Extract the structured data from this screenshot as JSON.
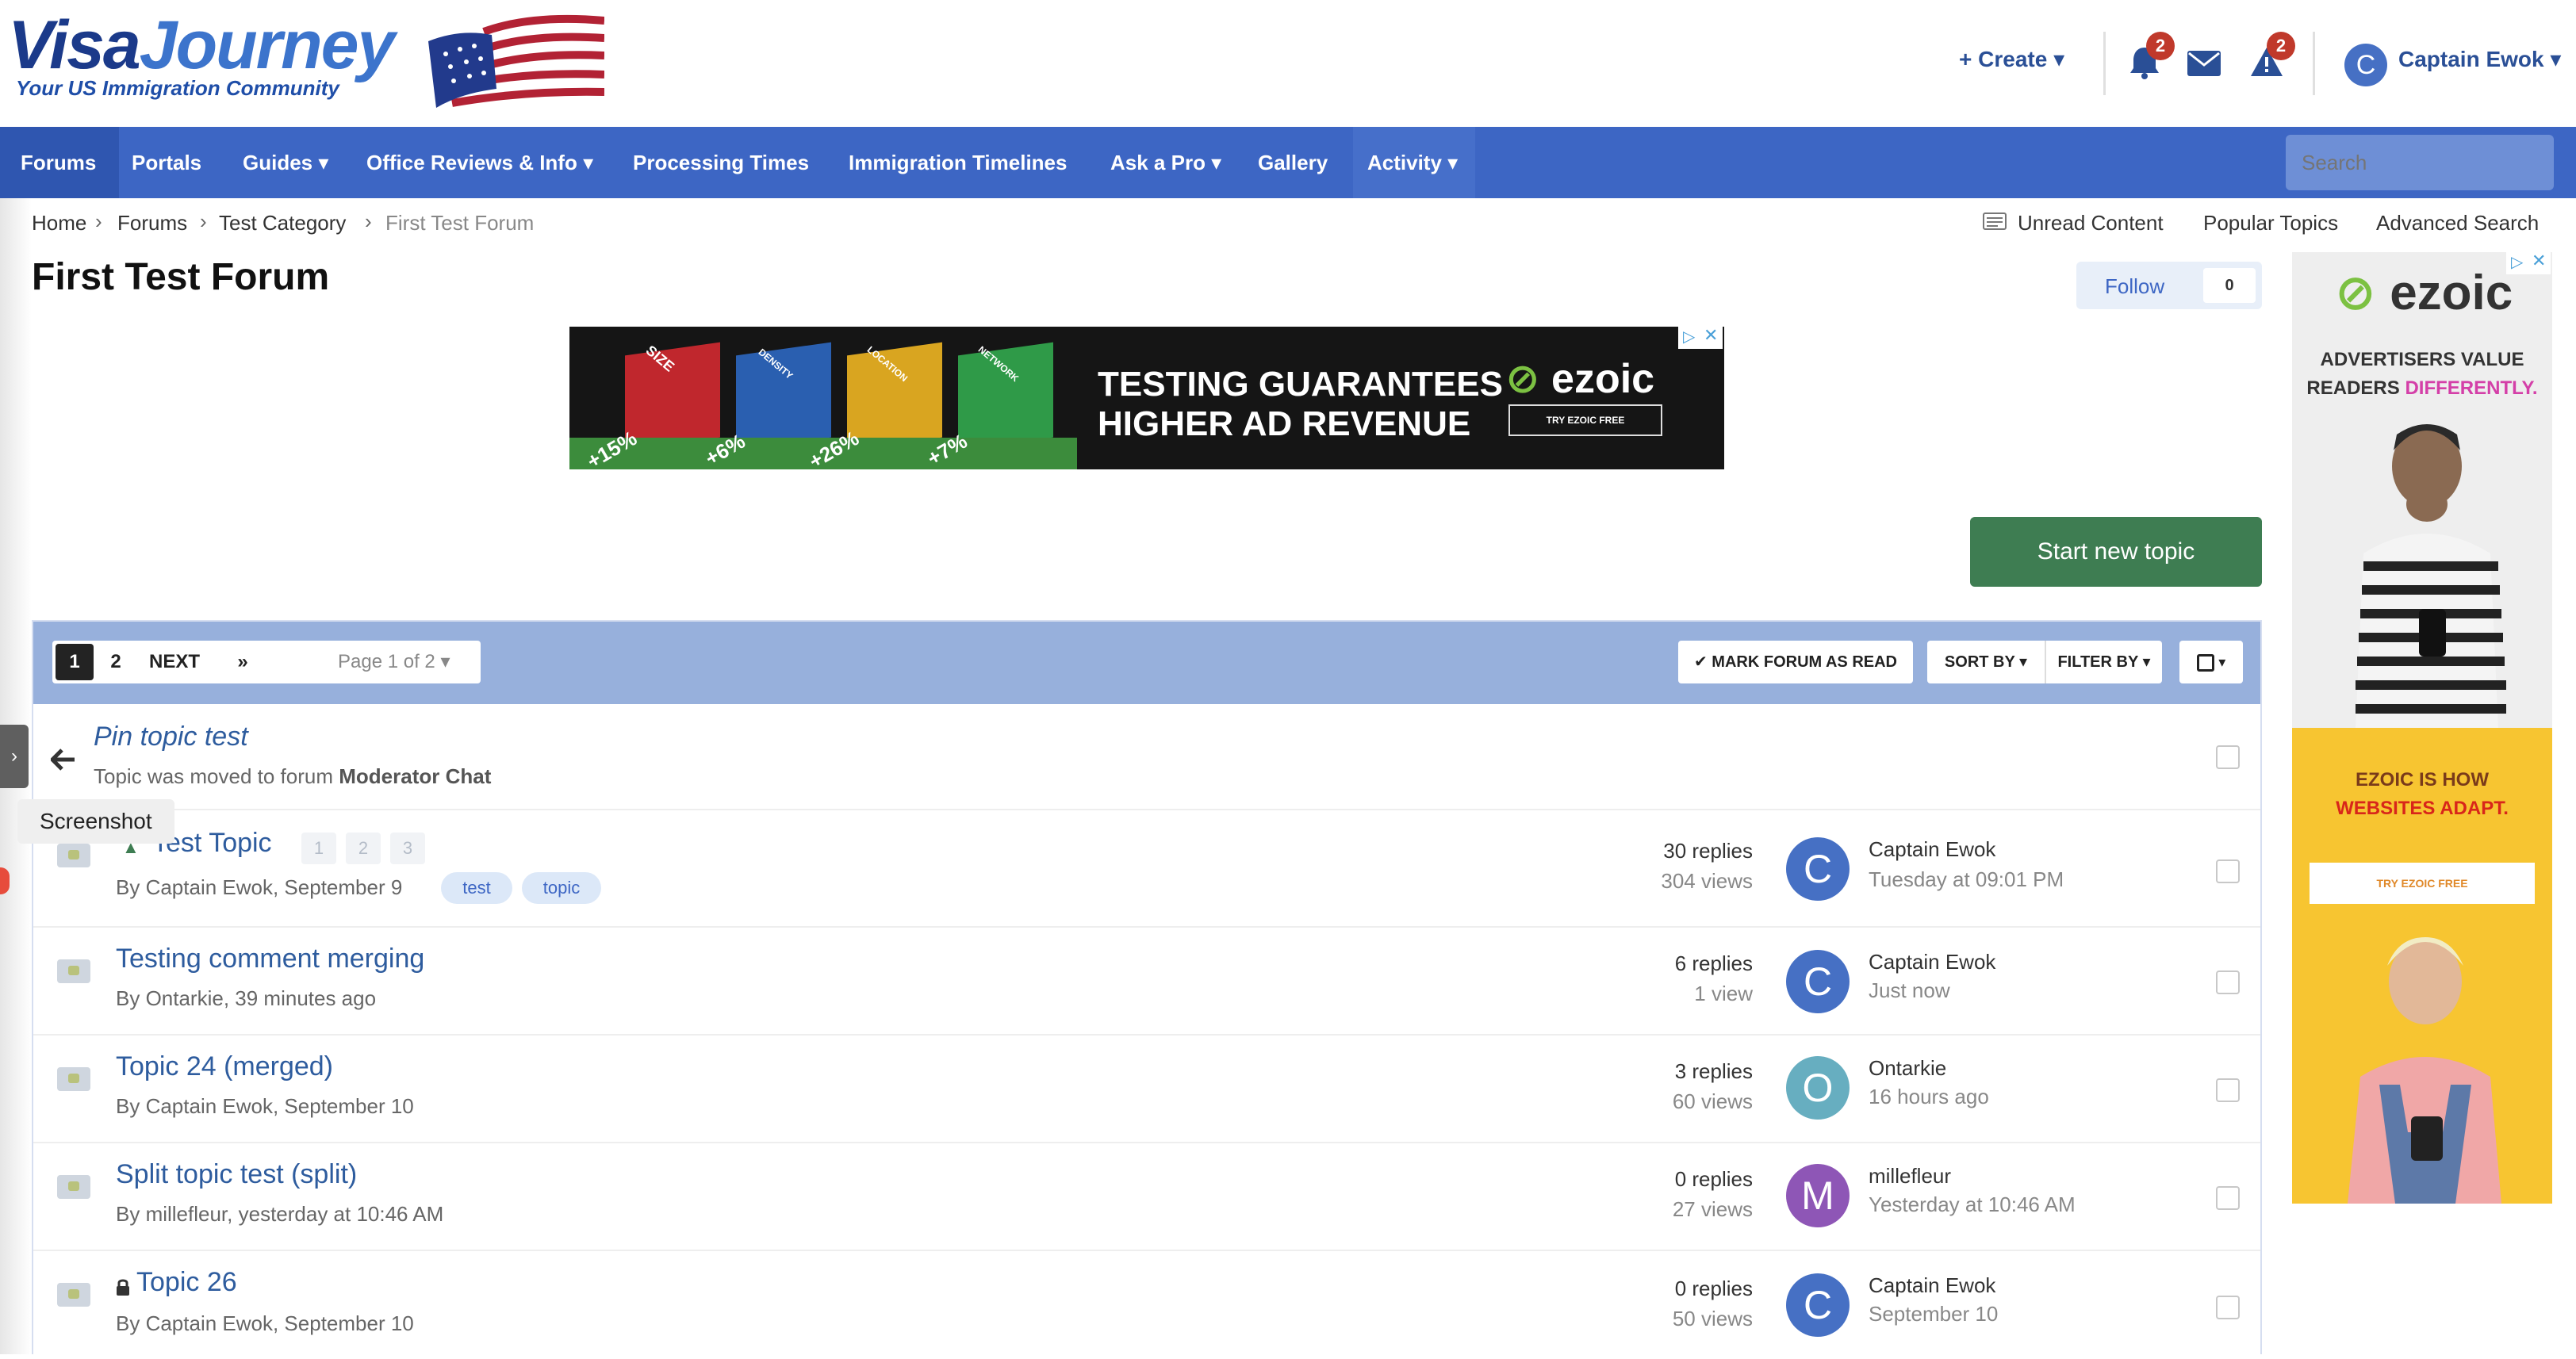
{
  "header": {
    "logo_part1": "Visa",
    "logo_part2": "Journey",
    "tagline": "Your US Immigration Community",
    "create_label": "Create",
    "notifications_count": "2",
    "reports_count": "2",
    "user_initial": "C",
    "user_name": "Captain Ewok"
  },
  "nav": {
    "items": [
      {
        "label": "Forums"
      },
      {
        "label": "Portals"
      },
      {
        "label": "Guides ▾"
      },
      {
        "label": "Office Reviews & Info ▾"
      },
      {
        "label": "Processing Times"
      },
      {
        "label": "Immigration Timelines"
      },
      {
        "label": "Ask a Pro ▾"
      },
      {
        "label": "Gallery"
      },
      {
        "label": "Activity ▾"
      }
    ],
    "search_placeholder": "Search"
  },
  "breadcrumb": [
    "Home",
    "Forums",
    "Test Category",
    "First Test Forum"
  ],
  "sublinks": {
    "unread": "Unread Content",
    "popular": "Popular Topics",
    "advanced": "Advanced Search"
  },
  "page": {
    "title": "First Test Forum",
    "follow_label": "Follow",
    "follow_count": "0",
    "start_topic": "Start new topic"
  },
  "banner_ad": {
    "line1": "TESTING GUARANTEES",
    "line2": "HIGHER AD REVENUE",
    "brand": "ezoic",
    "button": "TRY EZOIC FREE",
    "cubes": [
      {
        "label": "SIZE",
        "pct": "+15%",
        "color": "#c0272d"
      },
      {
        "label": "DENSITY",
        "pct": "+6%",
        "color": "#2a5fb0"
      },
      {
        "label": "LOCATION",
        "pct": "+26%",
        "color": "#d9a520"
      },
      {
        "label": "NETWORK",
        "pct": "+7%",
        "color": "#2f9a48"
      }
    ]
  },
  "toolbar": {
    "page1": "1",
    "page2": "2",
    "next": "NEXT",
    "last": "»",
    "page_jump": "Page 1 of 2",
    "mark_read": "✔ MARK FORUM AS READ",
    "sort_by": "SORT BY ▾",
    "filter_by": "FILTER BY ▾"
  },
  "topics": [
    {
      "title": "Pin topic test",
      "meta_prefix": "Topic was moved to forum ",
      "meta_strong": "Moderator Chat"
    },
    {
      "title": "Test Topic",
      "meta": "By Captain Ewok, September 9",
      "replies": "30 replies",
      "views": "304 views",
      "last_initial": "C",
      "last_user": "Captain Ewok",
      "last_time": "Tuesday at 09:01 PM",
      "tags": [
        "test",
        "topic"
      ],
      "pages": [
        "1",
        "2",
        "3"
      ]
    },
    {
      "title": "Testing comment merging",
      "meta": "By Ontarkie, 39 minutes ago",
      "replies": "6 replies",
      "views": "1 view",
      "last_initial": "C",
      "last_user": "Captain Ewok",
      "last_time": "Just now"
    },
    {
      "title": "Topic 24 (merged)",
      "meta": "By Captain Ewok, September 10",
      "replies": "3 replies",
      "views": "60 views",
      "last_initial": "O",
      "last_user": "Ontarkie",
      "last_time": "16 hours ago"
    },
    {
      "title": "Split topic test (split)",
      "meta": "By millefleur, yesterday at 10:46 AM",
      "replies": "0 replies",
      "views": "27 views",
      "last_initial": "M",
      "last_user": "millefleur",
      "last_time": "Yesterday at 10:46 AM"
    },
    {
      "title": "Topic 26",
      "meta": "By Captain Ewok, September 10",
      "replies": "0 replies",
      "views": "50 views",
      "last_initial": "C",
      "last_user": "Captain Ewok",
      "last_time": "September 10"
    }
  ],
  "side_ad": {
    "brand": "ezoic",
    "line1": "ADVERTISERS VALUE",
    "line2a": "READERS ",
    "line2b": "DIFFERENTLY.",
    "line3": "EZOIC IS HOW",
    "line4": "WEBSITES ADAPT.",
    "button": "TRY EZOIC FREE"
  },
  "screenshot_tooltip": "Screenshot",
  "colors": {
    "nav_bg": "#3d66c4",
    "toolbar_bg": "#97b0dc",
    "start_button": "#3e7d52",
    "link": "#2e5c9e",
    "badge": "#c0392b"
  }
}
